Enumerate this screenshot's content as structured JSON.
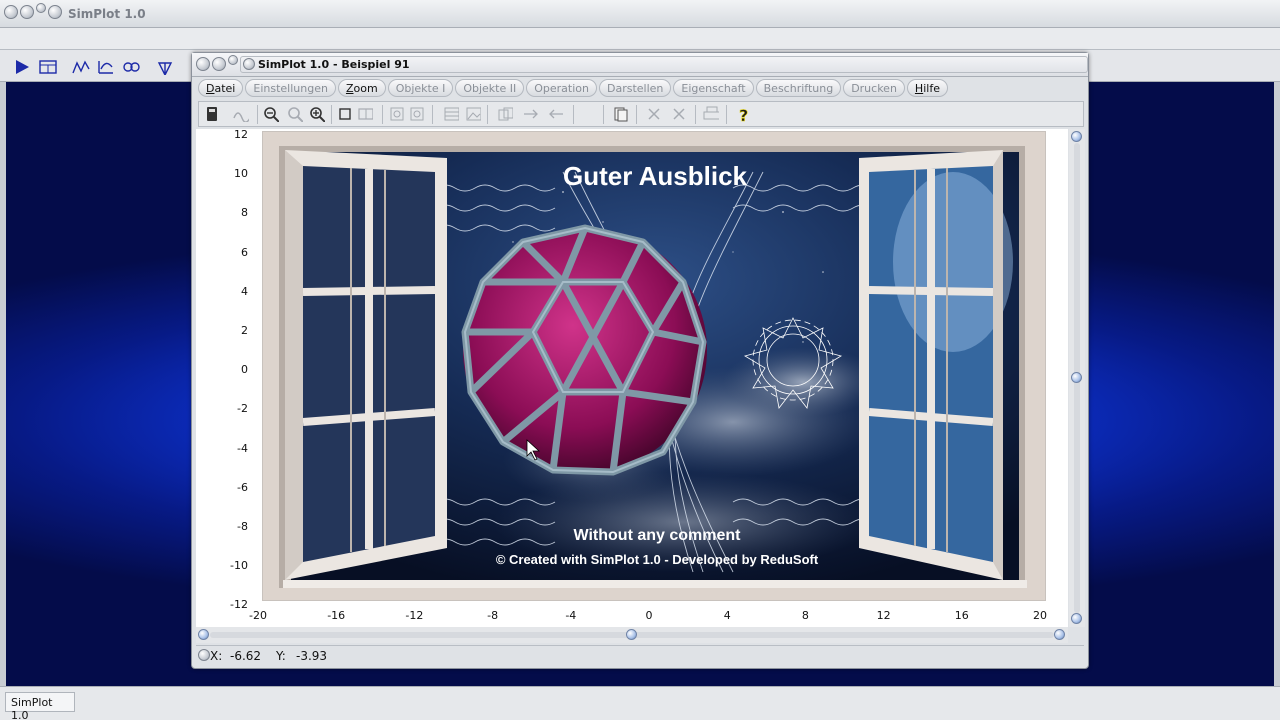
{
  "outer_window": {
    "title": "SimPlot 1.0",
    "taskbar_item": "SimPlot 1.0"
  },
  "inner_window": {
    "title": "SimPlot 1.0 - Beispiel 91"
  },
  "menu": [
    {
      "label": "Datei",
      "enabled": true
    },
    {
      "label": "Einstellungen",
      "enabled": false
    },
    {
      "label": "Zoom",
      "enabled": true
    },
    {
      "label": "Objekte I",
      "enabled": false
    },
    {
      "label": "Objekte II",
      "enabled": false
    },
    {
      "label": "Operation",
      "enabled": false
    },
    {
      "label": "Darstellen",
      "enabled": false
    },
    {
      "label": "Eigenschaft",
      "enabled": false
    },
    {
      "label": "Beschriftung",
      "enabled": false
    },
    {
      "label": "Drucken",
      "enabled": false
    },
    {
      "label": "Hilfe",
      "enabled": true
    }
  ],
  "plot": {
    "title": "Guter Ausblick",
    "comment": "Without any comment",
    "credit": "© Created with SimPlot 1.0 - Developed by ReduSoft",
    "x_ticks": [
      "-20",
      "-16",
      "-12",
      "-8",
      "-4",
      "0",
      "4",
      "8",
      "12",
      "16",
      "20"
    ],
    "y_ticks": [
      "12",
      "10",
      "8",
      "6",
      "4",
      "2",
      "0",
      "-2",
      "-4",
      "-6",
      "-8",
      "-10",
      "-12"
    ]
  },
  "status": {
    "x_label": "X:",
    "x_value": "-6.62",
    "y_label": "Y:",
    "y_value": "-3.93"
  },
  "colors": {
    "desktop_blue": "#0e35d9",
    "sky_dark": "#0b1a3a",
    "window_frame": "#e8e2dc",
    "polyhedron_fill": "#9a1060",
    "polyhedron_struts": "#7f98a6"
  }
}
